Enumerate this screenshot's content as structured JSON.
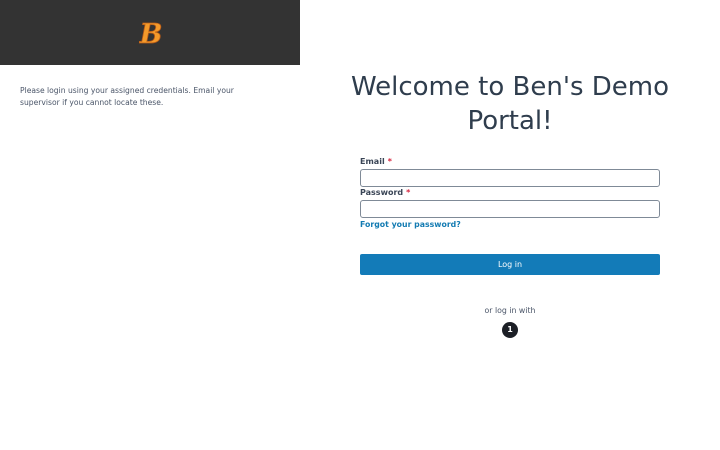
{
  "sidebar": {
    "logo_icon": "stylized-B-logo",
    "logo_letter": "B",
    "intro_text": "Please login using your assigned credentials. Email your supervisor if you cannot locate these."
  },
  "login": {
    "title": "Welcome to Ben's Demo Portal!",
    "email_label": "Email",
    "password_label": "Password",
    "required_marker": "*",
    "email_value": "",
    "password_value": "",
    "forgot_password": "Forgot your password?",
    "submit_label": "Log in",
    "alt_login_text": "or log in with",
    "provider_icon": "one-password-icon",
    "provider_glyph": "1"
  },
  "colors": {
    "logo_bar": "#333333",
    "logo_fill": "#f39a2b",
    "primary": "#137bb8",
    "link": "#137bb2",
    "required": "#d6243d"
  }
}
